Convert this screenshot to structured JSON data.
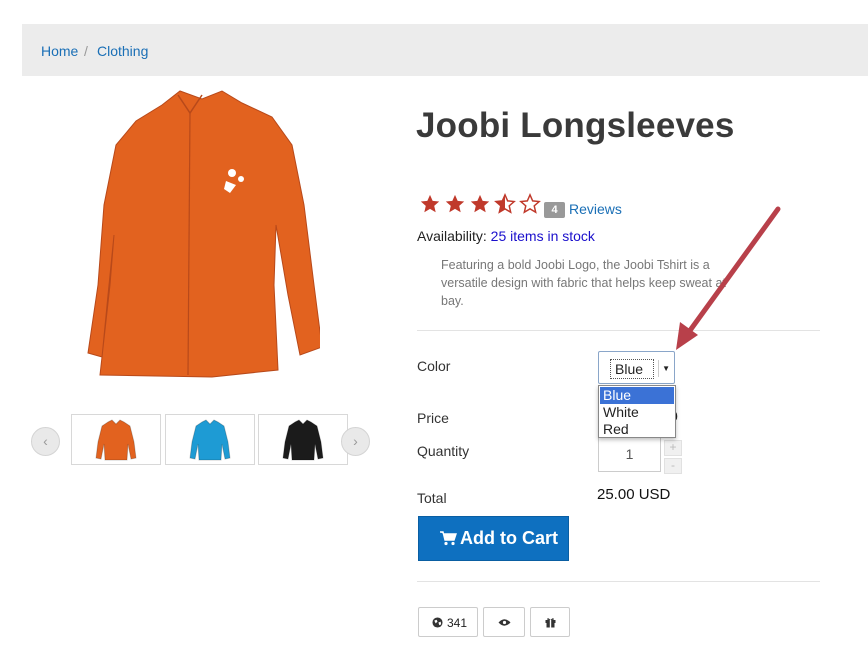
{
  "breadcrumb": {
    "home": "Home",
    "separator": "/",
    "current": "Clothing"
  },
  "product": {
    "title": "Joobi Longsleeves",
    "rating": 3.5,
    "rating_max": 5,
    "review_count": "4",
    "reviews_label": "Reviews",
    "availability_label": "Availability:",
    "availability_value": "25 items in stock",
    "description": "Featuring a bold Joobi Logo, the Joobi Tshirt is a versatile design with fabric that helps keep sweat at bay.",
    "main_image_color": "#e2621f"
  },
  "thumbnails": [
    {
      "name": "orange",
      "color": "#e2621f"
    },
    {
      "name": "blue",
      "color": "#1e9bd4"
    },
    {
      "name": "black",
      "color": "#1b1b1b"
    }
  ],
  "carousel": {
    "prev_icon": "chevron-left-icon",
    "next_icon": "chevron-right-icon"
  },
  "options": {
    "color_label": "Color",
    "color_selected": "Blue",
    "color_choices": [
      "Blue",
      "White",
      "Red"
    ],
    "price_label": "Price",
    "price_partial": "0",
    "quantity_label": "Quantity",
    "quantity_value": "1",
    "qty_plus": "+",
    "qty_minus": "-",
    "total_label": "Total",
    "total_value": "25.00 USD"
  },
  "actions": {
    "add_to_cart": "Add to Cart",
    "views_count": "341"
  },
  "colors": {
    "link": "#1a6fb6",
    "star": "#c0392b",
    "button": "#0e70c0",
    "annotation_arrow": "#b8404a",
    "dropdown_highlight": "#3b72d6"
  }
}
